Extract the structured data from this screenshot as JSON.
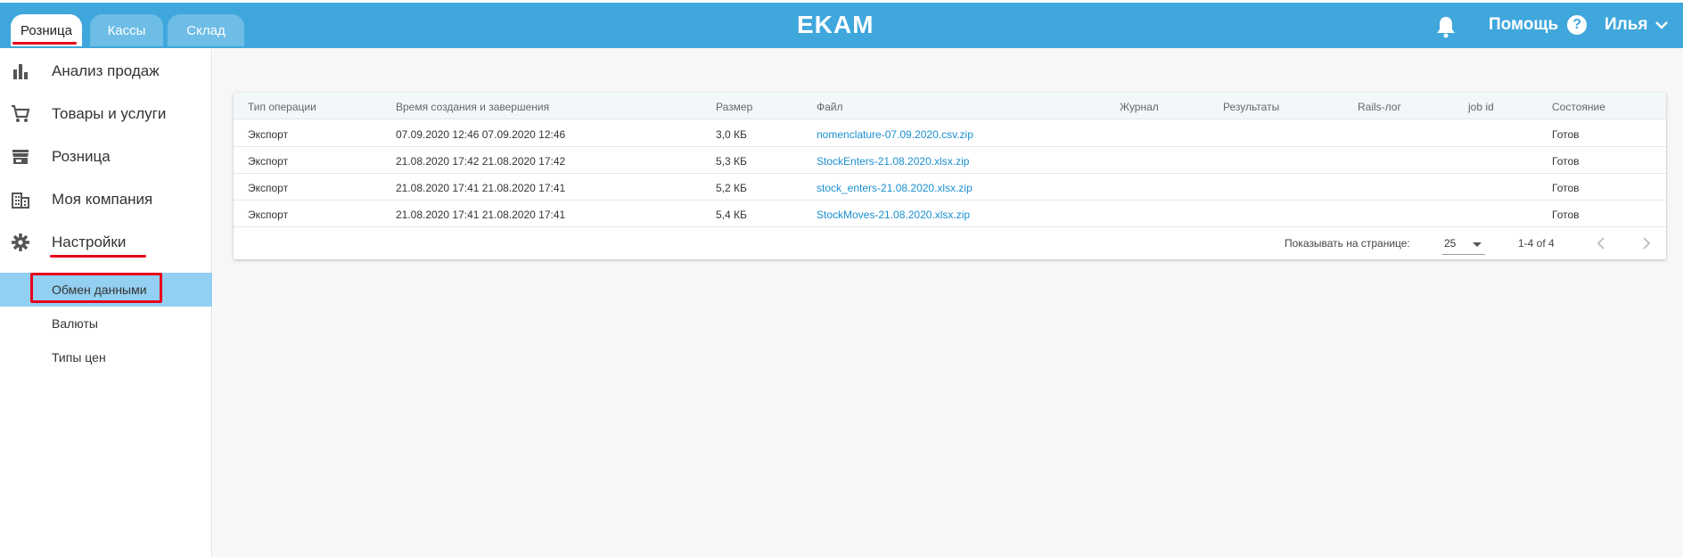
{
  "header": {
    "tabs": [
      {
        "label": "Розница",
        "active": true
      },
      {
        "label": "Кассы",
        "active": false
      },
      {
        "label": "Склад",
        "active": false
      }
    ],
    "logo": "EKAM",
    "help_label": "Помощь",
    "help_icon_glyph": "?",
    "user_name": "Илья"
  },
  "sidebar": {
    "items": [
      {
        "label": "Анализ продаж",
        "icon": "bar-chart-icon"
      },
      {
        "label": "Товары и услуги",
        "icon": "cart-icon"
      },
      {
        "label": "Розница",
        "icon": "store-icon"
      },
      {
        "label": "Моя компания",
        "icon": "building-icon"
      },
      {
        "label": "Настройки",
        "icon": "gear-icon"
      }
    ],
    "subitems": [
      {
        "label": "Обмен данными",
        "active": true
      },
      {
        "label": "Валюты",
        "active": false
      },
      {
        "label": "Типы цен",
        "active": false
      }
    ]
  },
  "table": {
    "columns": [
      "Тип операции",
      "Время создания и завершения",
      "Размер",
      "Файл",
      "Журнал",
      "Результаты",
      "Rails-лог",
      "job id",
      "Состояние"
    ],
    "rows": [
      {
        "type": "Экспорт",
        "time": "07.09.2020 12:46 07.09.2020 12:46",
        "size": "3,0 КБ",
        "file": "nomenclature-07.09.2020.csv.zip",
        "state": "Готов"
      },
      {
        "type": "Экспорт",
        "time": "21.08.2020 17:42 21.08.2020 17:42",
        "size": "5,3 КБ",
        "file": "StockEnters-21.08.2020.xlsx.zip",
        "state": "Готов"
      },
      {
        "type": "Экспорт",
        "time": "21.08.2020 17:41 21.08.2020 17:41",
        "size": "5,2 КБ",
        "file": "stock_enters-21.08.2020.xlsx.zip",
        "state": "Готов"
      },
      {
        "type": "Экспорт",
        "time": "21.08.2020 17:41 21.08.2020 17:41",
        "size": "5,4 КБ",
        "file": "StockMoves-21.08.2020.xlsx.zip",
        "state": "Готов"
      }
    ],
    "footer": {
      "per_page_label": "Показывать на странице:",
      "per_page_value": "25",
      "range": "1-4 of 4"
    }
  },
  "colors": {
    "accent": "#3fa7dc",
    "highlight": "#e6001b",
    "active_sub": "#93cff0",
    "link": "#1a8fd0"
  }
}
